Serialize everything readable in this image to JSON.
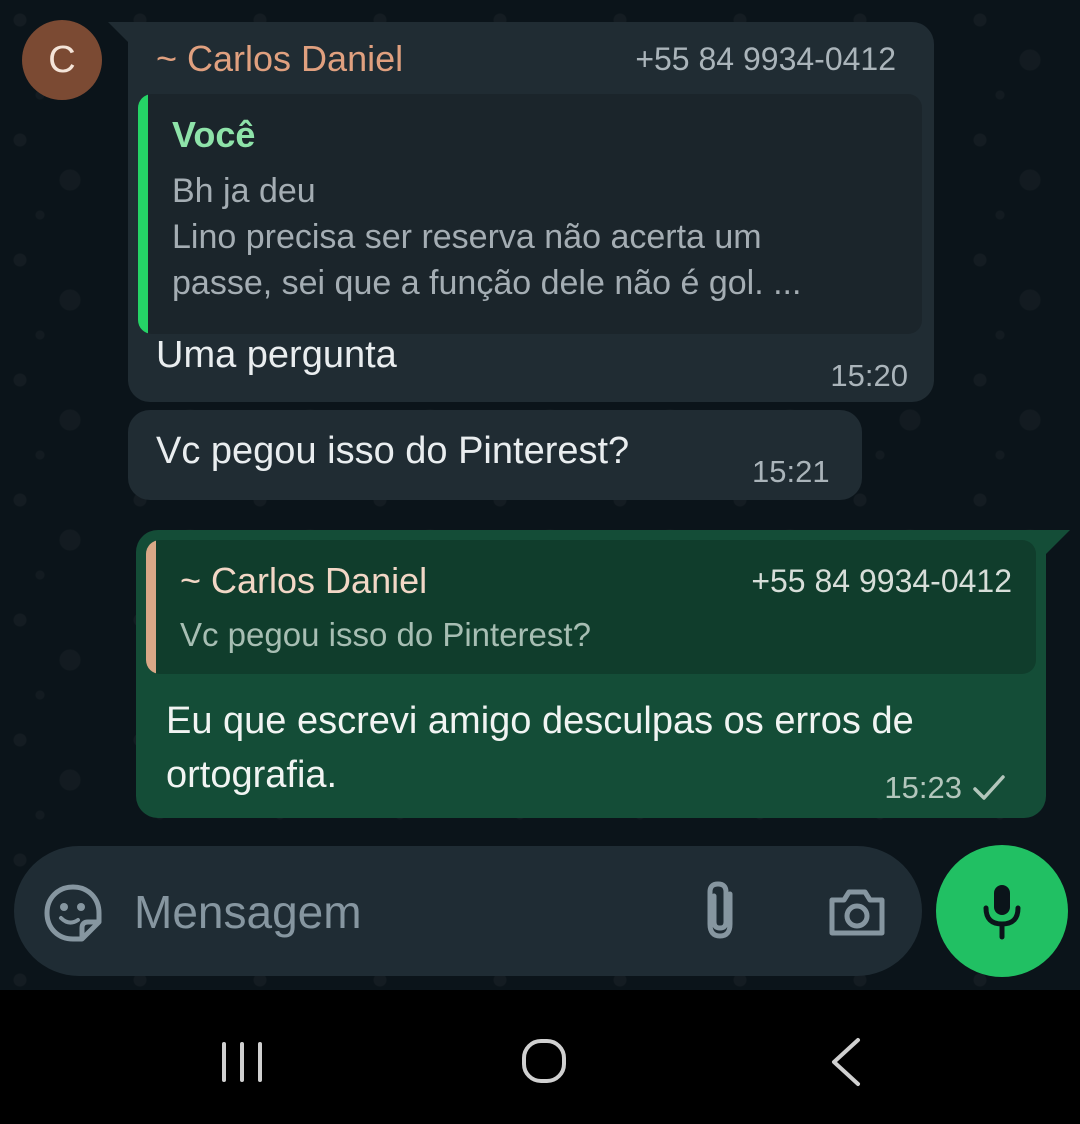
{
  "conversation": {
    "avatar_letter": "C",
    "message1": {
      "sender_name": "~ Carlos Daniel",
      "sender_phone": "+55 84 9934-0412",
      "quote": {
        "author": "Você",
        "text": "Bh ja deu\nLino precisa ser reserva não acerta um\npasse, sei que a função dele não é gol. ..."
      },
      "text": "Uma pergunta",
      "time": "15:20"
    },
    "message2": {
      "text": "Vc pegou isso do Pinterest?",
      "time": "15:21"
    },
    "message3": {
      "quote": {
        "sender_name": "~ Carlos Daniel",
        "sender_phone": "+55 84 9934-0412",
        "text": "Vc pegou isso do Pinterest?"
      },
      "text": "Eu que escrevi amigo desculpas os erros de ortografia.",
      "time": "15:23",
      "status_icon": "single-check-icon"
    }
  },
  "composer": {
    "placeholder": "Mensagem",
    "icons": [
      "sticker-icon",
      "paperclip-icon",
      "camera-icon",
      "microphone-icon"
    ]
  },
  "navbar": {
    "icons": [
      "recent-apps-icon",
      "home-icon",
      "back-icon"
    ]
  },
  "colors": {
    "background": "#0b141a",
    "incoming_bubble": "#202c33",
    "outgoing_bubble": "#144d37",
    "accent_green": "#21c063",
    "sender_name": "#e0a07f"
  }
}
